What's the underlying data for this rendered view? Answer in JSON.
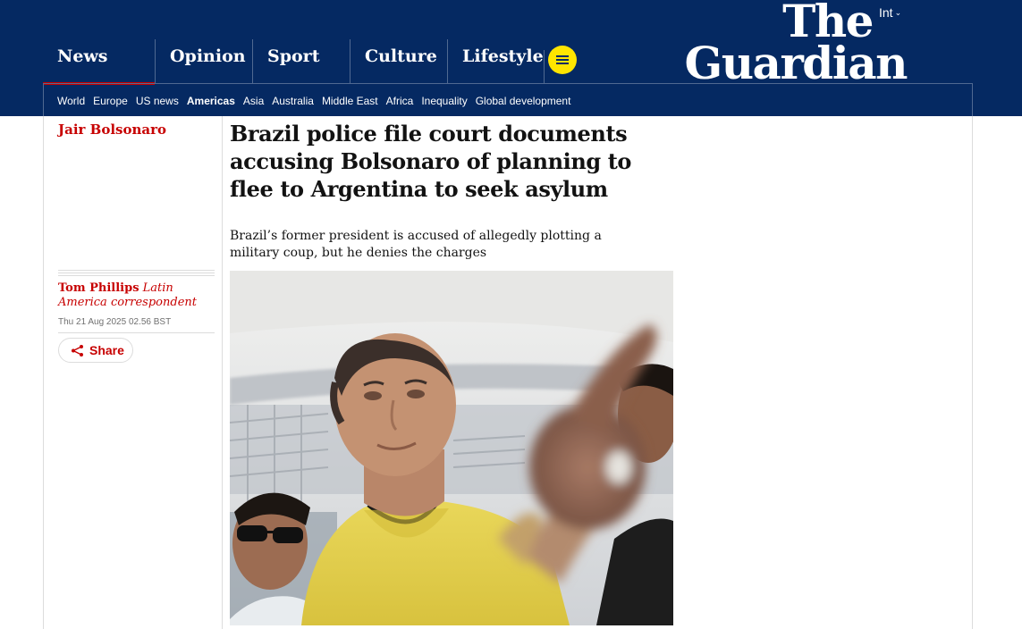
{
  "header": {
    "edition": "Int",
    "logo": {
      "line1": "The",
      "line2": "Guardian"
    },
    "pillars": [
      {
        "label": "News",
        "active": true
      },
      {
        "label": "Opinion",
        "active": false
      },
      {
        "label": "Sport",
        "active": false
      },
      {
        "label": "Culture",
        "active": false
      },
      {
        "label": "Lifestyle",
        "active": false
      }
    ],
    "menu_icon": "hamburger-icon",
    "subnav": [
      "World",
      "Europe",
      "US news",
      "Americas",
      "Asia",
      "Australia",
      "Middle East",
      "Africa",
      "Inequality",
      "Global development"
    ],
    "subnav_active": "Americas"
  },
  "article": {
    "series": "Jair Bolsonaro",
    "headline": "Brazil police file court documents accusing Bolsonaro of planning to flee to Argentina to seek asylum",
    "standfirst": "Brazil’s former president is accused of allegedly plotting a military coup, but he denies the charges",
    "author": "Tom Phillips",
    "author_role": "Latin America correspondent",
    "date": "Thu 21 Aug 2025 02.56 BST",
    "share_label": "Share",
    "share_icon": "share-icon"
  },
  "colors": {
    "brand_blue": "#052962",
    "news_red": "#c70000",
    "menu_yellow": "#ffe500"
  }
}
